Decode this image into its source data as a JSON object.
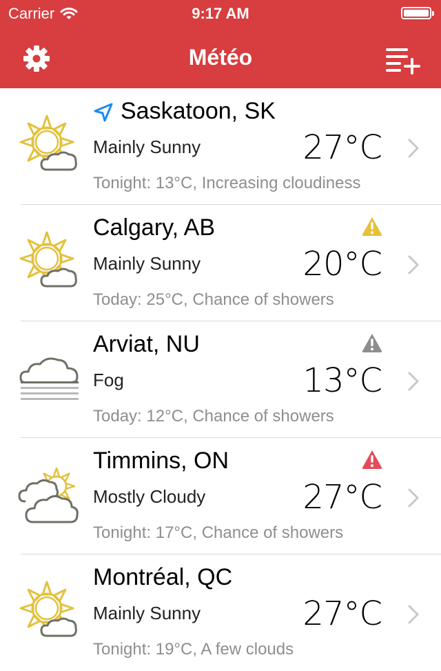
{
  "status_bar": {
    "carrier": "Carrier",
    "time": "9:17 AM"
  },
  "nav": {
    "title": "Météo"
  },
  "colors": {
    "header_bg": "#d83d3f",
    "alert_yellow": "#e6c039",
    "alert_gray": "#8e8e8e",
    "alert_red": "#e64a5a",
    "location_blue": "#1a8cf0"
  },
  "locations": [
    {
      "city": "Saskatoon, SK",
      "condition": "Mainly Sunny",
      "temperature": "27°C",
      "forecast": "Tonight: 13°C, Increasing cloudiness",
      "icon": "sun-with-small-cloud-icon",
      "current_location": true,
      "alert": null
    },
    {
      "city": "Calgary, AB",
      "condition": "Mainly Sunny",
      "temperature": "20°C",
      "forecast": "Today: 25°C, Chance of showers",
      "icon": "sun-with-small-cloud-icon",
      "current_location": false,
      "alert": "yellow"
    },
    {
      "city": "Arviat, NU",
      "condition": "Fog",
      "temperature": "13°C",
      "forecast": "Today: 12°C, Chance of showers",
      "icon": "fog-icon",
      "current_location": false,
      "alert": "gray"
    },
    {
      "city": "Timmins, ON",
      "condition": "Mostly Cloudy",
      "temperature": "27°C",
      "forecast": "Tonight: 17°C, Chance of showers",
      "icon": "cloudy-with-sun-icon",
      "current_location": false,
      "alert": "red"
    },
    {
      "city": "Montréal, QC",
      "condition": "Mainly Sunny",
      "temperature": "27°C",
      "forecast": "Tonight: 19°C, A few clouds",
      "icon": "sun-with-small-cloud-icon",
      "current_location": false,
      "alert": null
    }
  ]
}
